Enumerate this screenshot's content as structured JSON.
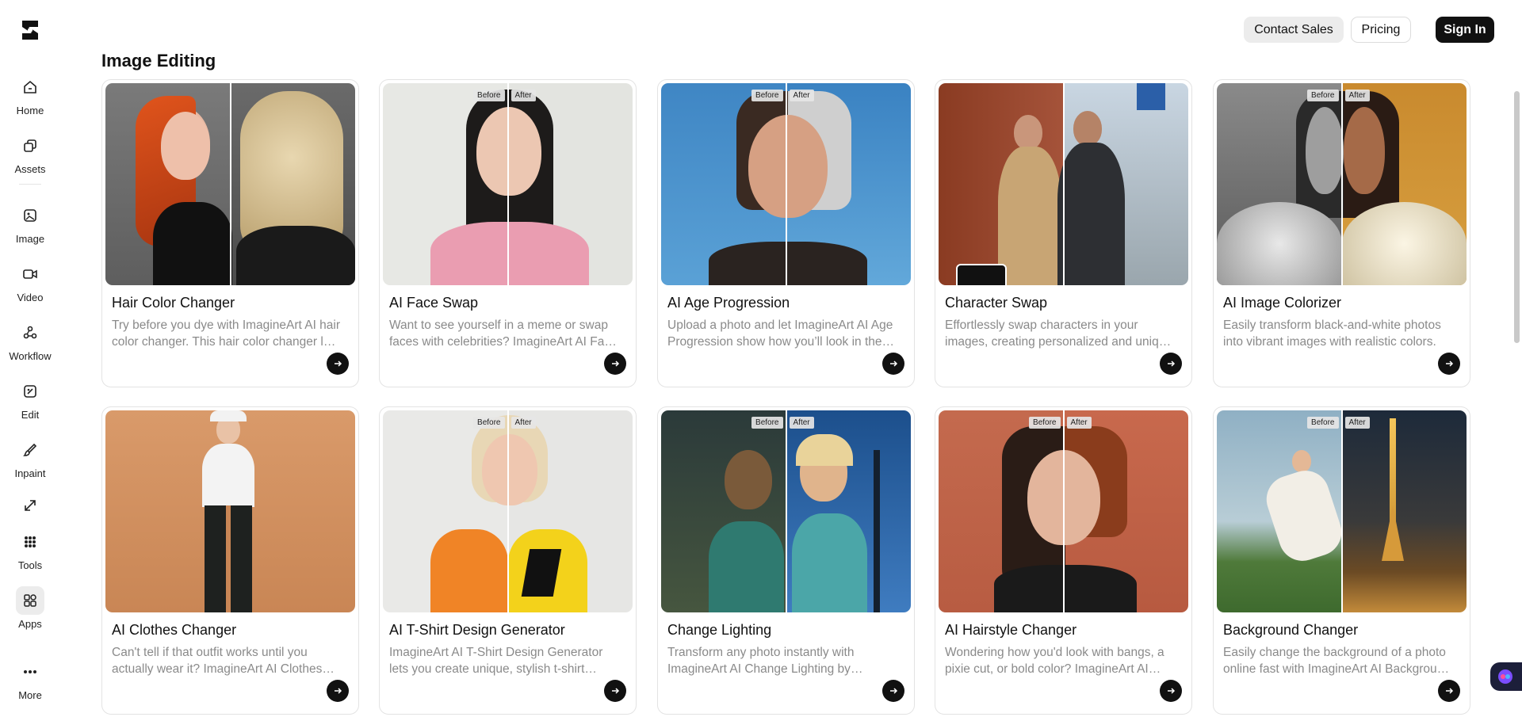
{
  "header": {
    "contact_sales": "Contact Sales",
    "pricing": "Pricing",
    "sign_in": "Sign In"
  },
  "sidebar": {
    "items": [
      {
        "label": "Home",
        "icon": "home-icon"
      },
      {
        "label": "Assets",
        "icon": "assets-icon"
      },
      {
        "label": "Image",
        "icon": "image-icon"
      },
      {
        "label": "Video",
        "icon": "video-icon"
      },
      {
        "label": "Workflow",
        "icon": "workflow-icon"
      },
      {
        "label": "Edit",
        "icon": "edit-icon"
      },
      {
        "label": "Inpaint",
        "icon": "inpaint-icon"
      },
      {
        "label": "",
        "icon": "upscale-icon"
      },
      {
        "label": "Tools",
        "icon": "tools-icon"
      },
      {
        "label": "Apps",
        "icon": "apps-icon"
      },
      {
        "label": "More",
        "icon": "more-icon"
      }
    ]
  },
  "main": {
    "section_title": "Image Editing",
    "before_label": "Before",
    "after_label": "After",
    "cards": [
      {
        "title": "Hair Color Changer",
        "desc": "Try before you dye with ImagineArt AI hair color changer. This hair color changer lets you preview new shades instantly."
      },
      {
        "title": "AI Face Swap",
        "desc": "Want to see yourself in a meme or swap faces with celebrities? ImagineArt AI Face Swap makes it easy."
      },
      {
        "title": "AI Age Progression",
        "desc": "Upload a photo and let ImagineArt AI Age Progression show how you’ll look in the future."
      },
      {
        "title": "Character Swap",
        "desc": "Effortlessly swap characters in your images, creating personalized and unique scenes."
      },
      {
        "title": "AI Image Colorizer",
        "desc": "Easily transform black-and-white photos into vibrant images with realistic colors."
      },
      {
        "title": "AI Clothes Changer",
        "desc": "Can't tell if that outfit works until you actually wear it? ImagineArt AI Clothes Changer lets you try it on."
      },
      {
        "title": "AI T-Shirt Design Generator",
        "desc": "ImagineArt AI T-Shirt Design Generator lets you create unique, stylish t-shirt designs in seconds."
      },
      {
        "title": "Change Lighting",
        "desc": "Transform any photo instantly with ImagineArt AI Change Lighting by adjusting light and mood."
      },
      {
        "title": "AI Hairstyle Changer",
        "desc": "Wondering how you'd look with bangs, a pixie cut, or bold color? ImagineArt AI Hairstyle Changer shows you."
      },
      {
        "title": "Background Changer",
        "desc": "Easily change the background of a photo online fast with ImagineArt AI Background Changer."
      }
    ]
  },
  "colors": {
    "accent": "#111111",
    "muted_text": "#8a8a8a",
    "border": "#e3e3e3"
  }
}
